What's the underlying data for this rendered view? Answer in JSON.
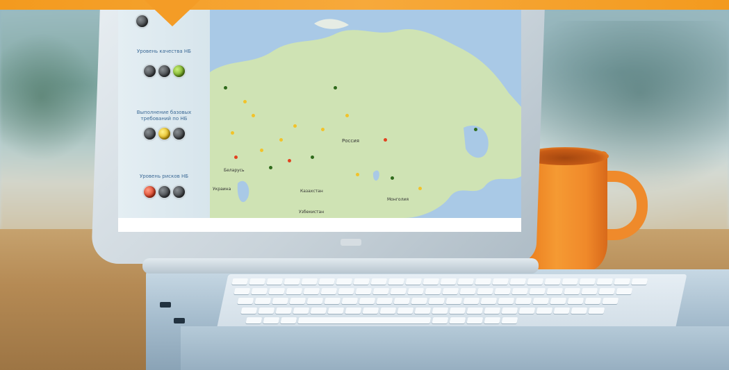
{
  "indicators": [
    {
      "label": "",
      "lights": [
        "off"
      ]
    },
    {
      "label": "Уровень качества НБ",
      "lights": [
        "off",
        "off",
        "green"
      ]
    },
    {
      "label": "Выполнение базовых требований по НБ",
      "lights": [
        "off",
        "yellow",
        "off"
      ]
    },
    {
      "label": "Уровень рисков НБ",
      "lights": [
        "red",
        "off",
        "off"
      ]
    }
  ],
  "map": {
    "labels": {
      "russia": "Россия",
      "kazakhstan": "Казахстан",
      "mongolia": "Монголия",
      "ukraine": "Украина",
      "uzbekistan": "Узбекистан",
      "belarus": "Беларусь"
    }
  },
  "colors": {
    "accent_orange": "#f39a1e",
    "light_green": "#6aa11a",
    "light_yellow": "#e1b10f",
    "light_red": "#d6371a",
    "light_off": "#3b3e41",
    "map_water": "#a9c9e6",
    "map_land": "#cfe3b4"
  }
}
